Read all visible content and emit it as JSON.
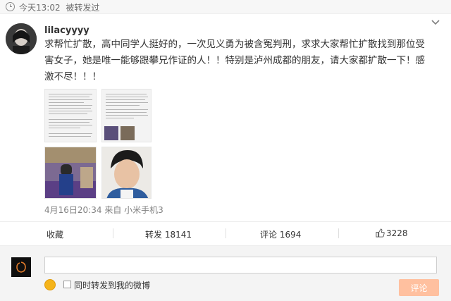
{
  "header": {
    "time": "今天13:02",
    "status": "被转发过"
  },
  "post": {
    "username": "lilacyyyy",
    "text": "求帮忙扩散，高中同学人挺好的，一次见义勇为被含冤判刑，求求大家帮忙扩散找到那位受害女子，她是唯一能够跟攀兄作证的人！！特别是泸州成都的朋友，请大家都扩散一下！感激不尽！！！",
    "date": "4月16日20:34",
    "source_prefix": "来自",
    "source": "小米手机3"
  },
  "actions": {
    "collect": "收藏",
    "repost": "转发 18141",
    "comment": "评论 1694",
    "like": "3228"
  },
  "comment_box": {
    "placeholder": "",
    "checkbox_label": "同时转发到我的微博",
    "submit": "评论"
  },
  "colors": {
    "submit_bg": "#ffc09f",
    "meta_text": "#808080"
  },
  "icons": [
    "clock-icon",
    "chevron-down-icon",
    "emoji-icon",
    "thumbs-up-icon"
  ]
}
